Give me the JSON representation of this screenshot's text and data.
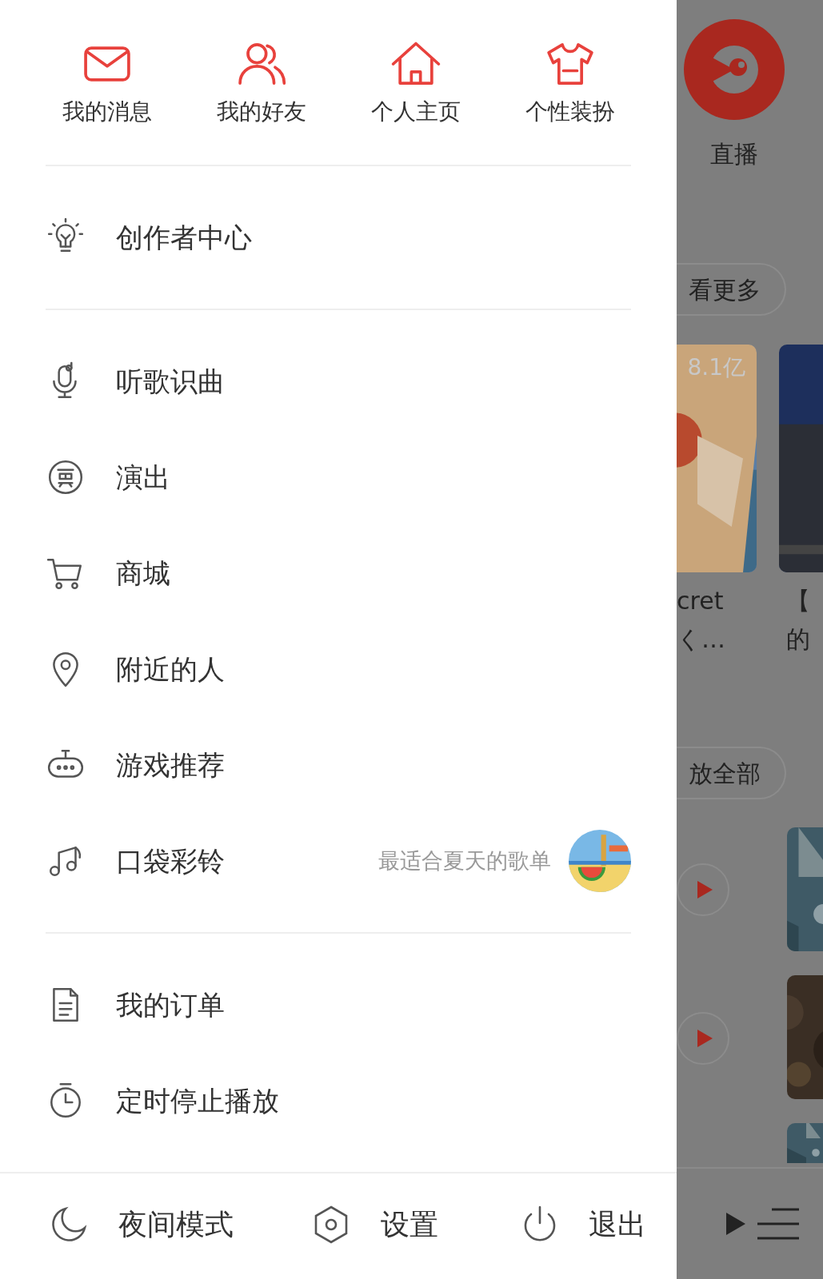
{
  "quick_actions": [
    {
      "label": "我的消息"
    },
    {
      "label": "我的好友"
    },
    {
      "label": "个人主页"
    },
    {
      "label": "个性装扮"
    }
  ],
  "menu_sections": [
    {
      "items": [
        {
          "label": "创作者中心"
        }
      ]
    },
    {
      "items": [
        {
          "label": "听歌识曲"
        },
        {
          "label": "演出"
        },
        {
          "label": "商城"
        },
        {
          "label": "附近的人"
        },
        {
          "label": "游戏推荐"
        },
        {
          "label": "口袋彩铃",
          "promo": "最适合夏天的歌单"
        }
      ]
    },
    {
      "items": [
        {
          "label": "我的订单"
        },
        {
          "label": "定时停止播放"
        }
      ]
    }
  ],
  "footer": [
    {
      "label": "夜间模式"
    },
    {
      "label": "设置"
    },
    {
      "label": "退出"
    }
  ],
  "background_page": {
    "live_label": "直播",
    "more_button": "看更多",
    "view_count": "8.1亿",
    "cards": [
      {
        "title_lines": [
          "cret",
          "く…"
        ]
      },
      {
        "title_lines": [
          "【",
          "的"
        ]
      }
    ],
    "play_all_button": "放全部"
  }
}
